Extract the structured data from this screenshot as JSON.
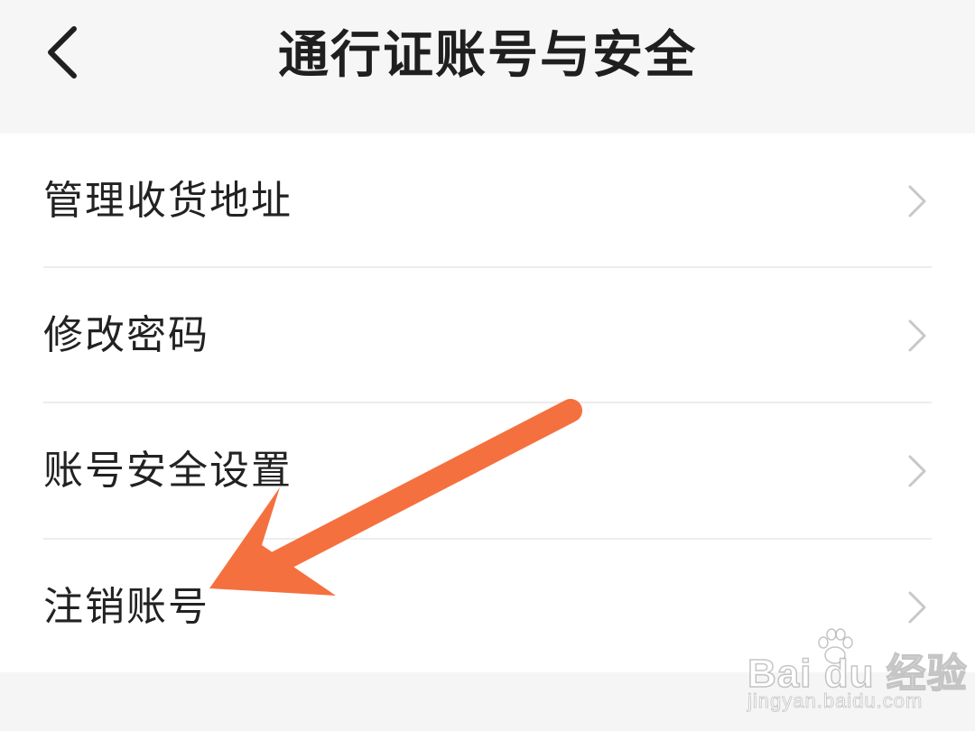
{
  "header": {
    "title": "通行证账号与安全",
    "back_icon": "chevron-left-icon"
  },
  "menu": {
    "items": [
      {
        "label": "管理收货地址",
        "icon": "chevron-right-icon"
      },
      {
        "label": "修改密码",
        "icon": "chevron-right-icon"
      },
      {
        "label": "账号安全设置",
        "icon": "chevron-right-icon"
      },
      {
        "label": "注销账号",
        "icon": "chevron-right-icon"
      }
    ]
  },
  "annotation": {
    "arrow_color": "#f5703f",
    "points_to": "注销账号"
  },
  "watermark": {
    "brand": "Bai du 经验",
    "url": "jingyan.baidu.com"
  },
  "colors": {
    "background": "#f5f5f5",
    "list_background": "#ffffff",
    "text": "#222222",
    "chevron": "#c8c8c8",
    "divider": "#ececec"
  }
}
